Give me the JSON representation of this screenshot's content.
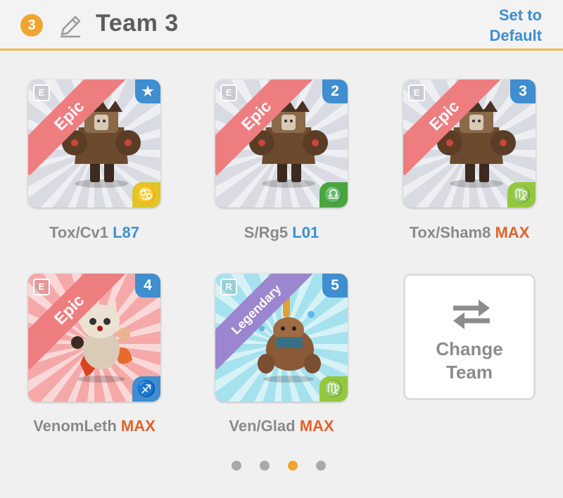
{
  "header": {
    "team_number": "3",
    "title": "Team 3",
    "set_default": "Set to Default",
    "accent": "#f2b94a"
  },
  "cards": [
    {
      "rarity": "Epic",
      "type_icon": "E",
      "corner": "star",
      "corner_text": "★",
      "zodiac": "♋",
      "zodiac_color": "#e1c428",
      "bg": "#d9dbe3",
      "name": "Tox/Cv1",
      "level": "L87",
      "level_style": "blue"
    },
    {
      "rarity": "Epic",
      "type_icon": "E",
      "corner": "number",
      "corner_text": "2",
      "zodiac": "♎",
      "zodiac_color": "#4aa53e",
      "bg": "#d9dbe3",
      "name": "S/Rg5",
      "level": "L01",
      "level_style": "blue"
    },
    {
      "rarity": "Epic",
      "type_icon": "E",
      "corner": "number",
      "corner_text": "3",
      "zodiac": "♍",
      "zodiac_color": "#93c83d",
      "bg": "#d9dbe3",
      "name": "Tox/Sham8",
      "level": "MAX",
      "level_style": "max"
    },
    {
      "rarity": "Epic",
      "type_icon": "E",
      "corner": "number",
      "corner_text": "4",
      "zodiac": "♐",
      "zodiac_color": "#3e8ed0",
      "bg": "#f4a9a8",
      "name": "VenomLeth",
      "level": "MAX",
      "level_style": "max"
    },
    {
      "rarity": "Legendary",
      "type_icon": "R",
      "corner": "number",
      "corner_text": "5",
      "zodiac": "♍",
      "zodiac_color": "#93c83d",
      "bg": "#a6e2ee",
      "name": "Ven/Glad",
      "level": "MAX",
      "level_style": "max"
    }
  ],
  "change_team": {
    "line1": "Change",
    "line2": "Team"
  },
  "pagination": {
    "pages": 4,
    "active": 3
  }
}
